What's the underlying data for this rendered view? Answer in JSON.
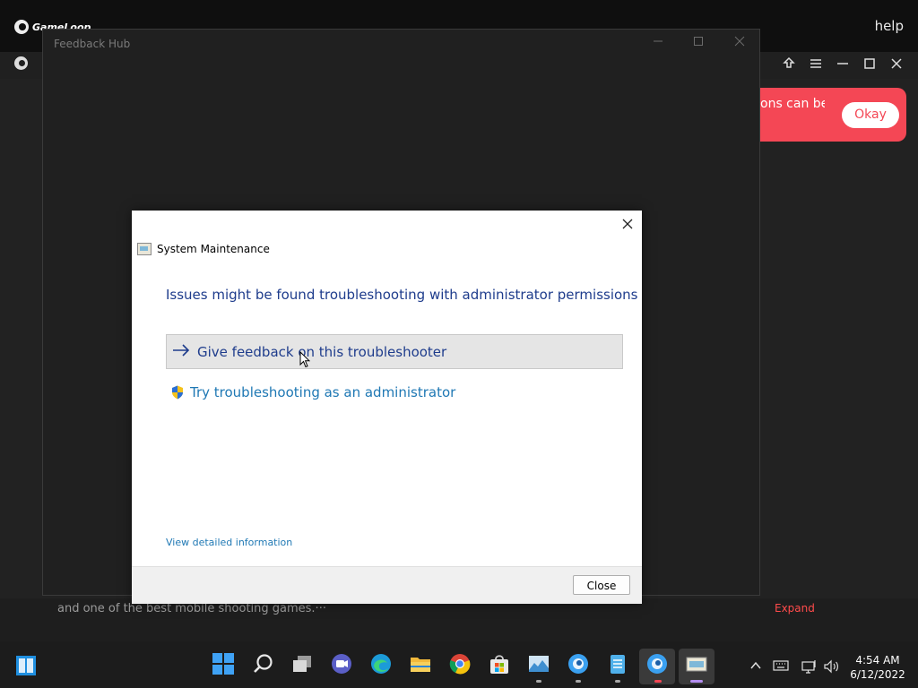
{
  "background_app": {
    "brand": "GameLoop",
    "help": "help",
    "notice_text": "ons can be",
    "okay_button": "Okay",
    "description": "and one of the best mobile shooting games.···",
    "expand": "Expand",
    "accent_color": "#f44755"
  },
  "feedback_hub": {
    "title": "Feedback Hub",
    "controls": [
      "minimize",
      "maximize",
      "close"
    ]
  },
  "dialog": {
    "title": "System Maintenance",
    "heading": "Issues might be found troubleshooting with administrator permissions",
    "option_feedback": "Give feedback on this troubleshooter",
    "option_admin": "Try troubleshooting as an administrator",
    "details_link": "View detailed information",
    "close_button": "Close",
    "heading_color": "#1e3c8c",
    "link_color": "#1f78b4"
  },
  "taskbar": {
    "apps": [
      "windows-start-icon",
      "search-icon",
      "task-view-icon",
      "chat-icon",
      "edge-icon",
      "file-explorer-icon",
      "chrome-icon",
      "store-icon",
      "photos-icon",
      "gameloop-icon",
      "notepad-icon",
      "gameloop-active-icon",
      "system-maintenance-icon"
    ],
    "clock_time": "4:54 AM",
    "clock_date": "6/12/2022"
  }
}
